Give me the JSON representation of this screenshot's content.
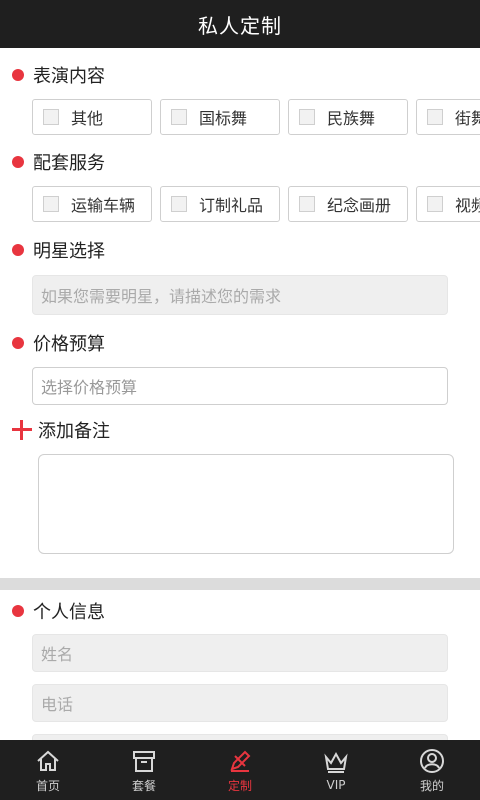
{
  "header": {
    "title": "私人定制"
  },
  "sections": {
    "performance": {
      "title": "表演内容",
      "options": [
        "其他",
        "国标舞",
        "民族舞",
        "街舞"
      ]
    },
    "services": {
      "title": "配套服务",
      "options": [
        "运输车辆",
        "订制礼品",
        "纪念画册",
        "视频"
      ]
    },
    "star": {
      "title": "明星选择",
      "placeholder": "如果您需要明星，请描述您的需求"
    },
    "budget": {
      "title": "价格预算",
      "placeholder": "选择价格预算"
    },
    "notes": {
      "title": "添加备注"
    },
    "personal": {
      "title": "个人信息",
      "name_placeholder": "姓名",
      "phone_placeholder": "电话"
    }
  },
  "tabbar": {
    "items": [
      {
        "label": "首页",
        "icon": "home-icon"
      },
      {
        "label": "套餐",
        "icon": "package-icon"
      },
      {
        "label": "定制",
        "icon": "customize-icon",
        "active": true
      },
      {
        "label": "VIP",
        "icon": "crown-icon"
      },
      {
        "label": "我的",
        "icon": "user-icon"
      }
    ],
    "active_color": "#e8353f"
  },
  "colors": {
    "accent": "#e8353f",
    "header_bg": "#1f1f1f"
  }
}
